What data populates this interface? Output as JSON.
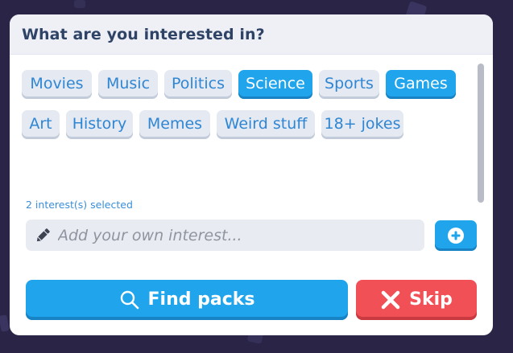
{
  "dialog": {
    "title": "What are you interested in?"
  },
  "interests": {
    "rows": [
      [
        {
          "label": "Movies",
          "selected": false
        },
        {
          "label": "Music",
          "selected": false
        },
        {
          "label": "Politics",
          "selected": false
        },
        {
          "label": "Science",
          "selected": true
        },
        {
          "label": "Sports",
          "selected": false
        },
        {
          "label": "Games",
          "selected": true
        }
      ],
      [
        {
          "label": "Art",
          "selected": false
        },
        {
          "label": "History",
          "selected": false
        },
        {
          "label": "Memes",
          "selected": false
        },
        {
          "label": "Weird stuff",
          "selected": false
        },
        {
          "label": "18+ jokes",
          "selected": false
        }
      ]
    ],
    "selected_count_text": "2 interest(s) selected"
  },
  "custom_input": {
    "value": "",
    "placeholder": "Add your own interest...",
    "icon": "pencil-icon",
    "add_icon": "plus-circle-icon"
  },
  "actions": {
    "find_label": "Find packs",
    "find_icon": "search-icon",
    "skip_label": "Skip",
    "skip_icon": "close-icon"
  },
  "colors": {
    "accent": "#20a5ec",
    "chip_bg": "#e4e9f2",
    "chip_text": "#2f86d3",
    "danger": "#f05056",
    "title": "#2f4366",
    "background": "#2a2547"
  }
}
